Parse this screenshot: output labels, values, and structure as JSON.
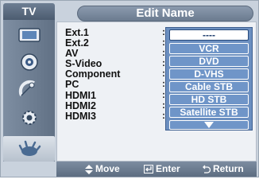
{
  "header": {
    "tv_label": "TV",
    "title": "Edit Name"
  },
  "sidebar": {
    "items": [
      {
        "icon": "input-icon",
        "active": false
      },
      {
        "icon": "sound-icon",
        "active": false
      },
      {
        "icon": "channel-icon",
        "active": false
      },
      {
        "icon": "setup-icon",
        "active": false
      },
      {
        "icon": "input-source-icon",
        "active": true
      }
    ]
  },
  "sources": [
    "Ext.1",
    "Ext.2",
    "AV",
    "S-Video",
    "Component",
    "PC",
    "HDMI1",
    "HDMI2",
    "HDMI3"
  ],
  "name_options": [
    "----",
    "VCR",
    "DVD",
    "D-VHS",
    "Cable STB",
    "HD STB",
    "Satellite STB"
  ],
  "selected_option": "----",
  "footer": {
    "move": "Move",
    "enter": "Enter",
    "return": "Return"
  },
  "colors": {
    "list_background": "#6b8fc0",
    "frame": "#c9d2dd",
    "bar": "#6b7b8f"
  }
}
